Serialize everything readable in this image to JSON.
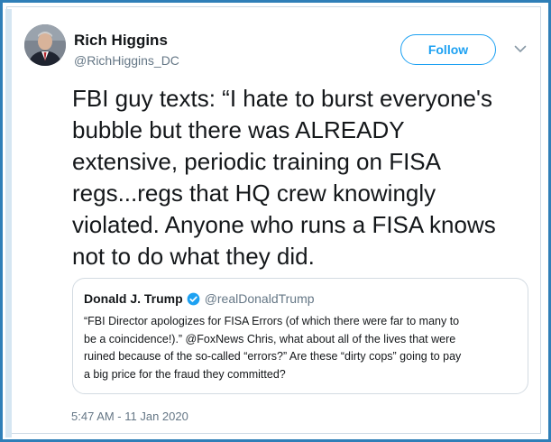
{
  "tweet": {
    "author": {
      "display_name": "Rich Higgins",
      "handle": "@RichHiggins_DC"
    },
    "follow_label": "Follow",
    "text_lines": [
      "FBI guy texts:  “I hate to burst everyone's",
      "bubble but there was ALREADY",
      "extensive, periodic training on FISA",
      "regs...regs that HQ crew knowingly",
      "violated.  Anyone who runs a FISA knows",
      "not to do what they did."
    ],
    "timestamp": "5:47 AM - 11 Jan 2020"
  },
  "quoted_tweet": {
    "display_name": "Donald J. Trump",
    "handle": "@realDonaldTrump",
    "text_lines": [
      "“FBI Director apologizes for FISA Errors (of which there were far to many to",
      "be a coincidence!).” @FoxNews Chris, what about all of the lives that were",
      "ruined because of the so-called “errors?” Are these “dirty cops” going to pay",
      "a big price for the fraud they committed?"
    ]
  },
  "colors": {
    "frame_border": "#2f7fb8",
    "accent": "#1da1f2",
    "text": "#14171a",
    "secondary_text": "#657786"
  },
  "icons": {
    "verified": "verified-badge-icon",
    "caret": "chevron-down-icon"
  }
}
